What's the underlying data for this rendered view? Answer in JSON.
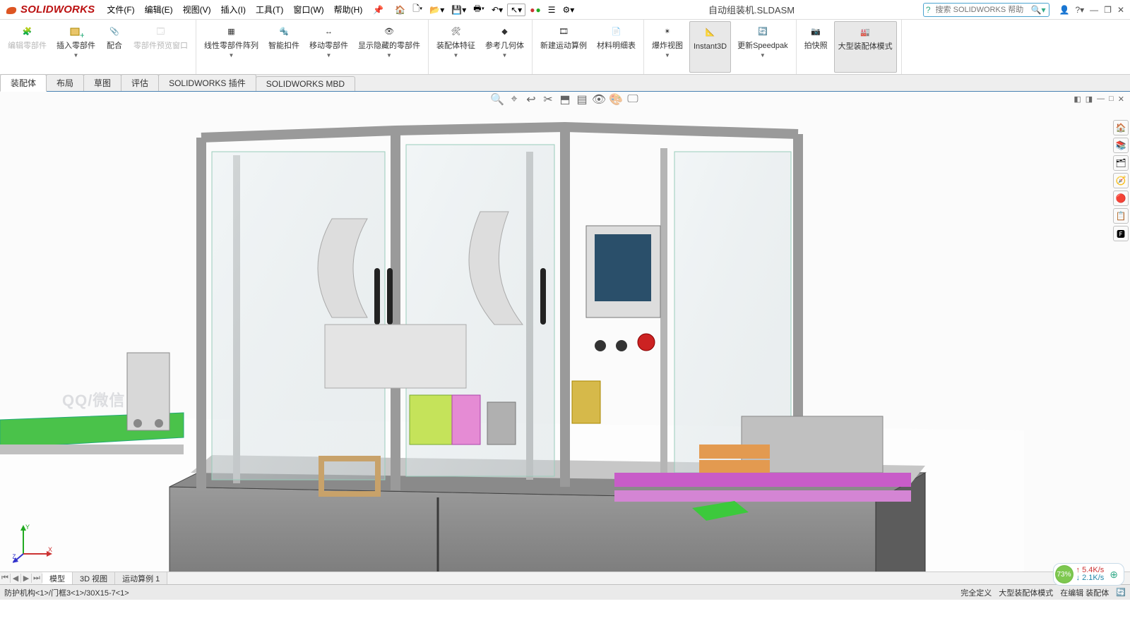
{
  "app": {
    "brand": "SOLIDWORKS"
  },
  "menu": {
    "file": "文件(F)",
    "edit": "编辑(E)",
    "view": "视图(V)",
    "insert": "插入(I)",
    "tools": "工具(T)",
    "window": "窗口(W)",
    "help": "帮助(H)"
  },
  "document": {
    "name": "自动组装机.SLDASM"
  },
  "search": {
    "placeholder": "搜索 SOLIDWORKS 帮助"
  },
  "ribbon": {
    "edit_part": "编辑零部件",
    "insert_part": "插入零部件",
    "mate": "配合",
    "part_preview": "零部件预览窗口",
    "linear_pattern": "线性零部件阵列",
    "smart_fastener": "智能扣件",
    "move_part": "移动零部件",
    "show_hide": "显示隐藏的零部件",
    "asm_feature": "装配体特征",
    "ref_geom": "参考几何体",
    "new_motion": "新建运动算例",
    "bom": "材料明细表",
    "exploded": "爆炸视图",
    "instant3d": "Instant3D",
    "update_sp": "更新Speedpak",
    "snapshot": "拍快照",
    "large_asm": "大型装配体模式"
  },
  "tabs": {
    "assembly": "装配体",
    "layout": "布局",
    "sketch": "草图",
    "evaluate": "评估",
    "addins": "SOLIDWORKS 插件",
    "mbd": "SOLIDWORKS MBD"
  },
  "bottom_tabs": {
    "model": "模型",
    "view3d": "3D 视图",
    "motion1": "运动算例 1"
  },
  "status": {
    "breadcrumb": "防护机构<1>/门框3<1>/30X15-7<1>",
    "fully_defined": "完全定义",
    "large_mode": "大型装配体模式",
    "editing": "在编辑 装配体"
  },
  "net": {
    "pct": "73%",
    "up": "5.4K/s",
    "down": "2.1K/s"
  },
  "watermark": "QQ/微信"
}
